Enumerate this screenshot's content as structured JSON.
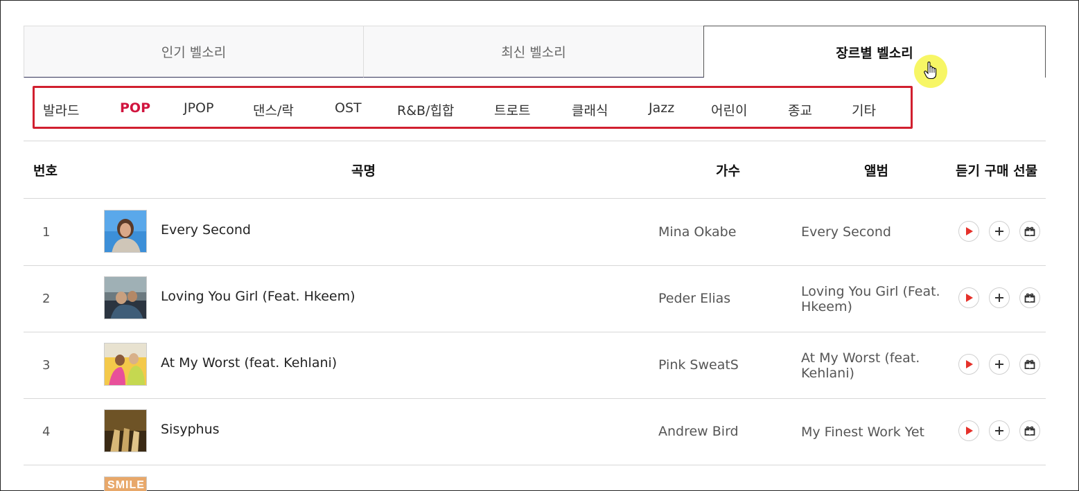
{
  "tabs": [
    "인기 벨소리",
    "최신 벨소리",
    "장르별 벨소리"
  ],
  "active_tab": 2,
  "genres": [
    "발라드",
    "POP",
    "JPOP",
    "댄스/락",
    "OST",
    "R&B/힙합",
    "트로트",
    "클래식",
    "Jazz",
    "어린이",
    "종교",
    "기타"
  ],
  "active_genre": 1,
  "table": {
    "headers": {
      "number": "번호",
      "title": "곡명",
      "artist": "가수",
      "album": "앨범",
      "actions": "듣기 구매 선물"
    },
    "rows": [
      {
        "num": "1",
        "title": "Every Second",
        "artist": "Mina Okabe",
        "album": "Every Second"
      },
      {
        "num": "2",
        "title": "Loving You Girl (Feat. Hkeem)",
        "artist": "Peder Elias",
        "album": "Loving You Girl (Feat. Hkeem)"
      },
      {
        "num": "3",
        "title": "At My Worst (feat. Kehlani)",
        "artist": "Pink SweatS",
        "album": "At My Worst (feat. Kehlani)"
      },
      {
        "num": "4",
        "title": "Sisyphus",
        "artist": "Andrew Bird",
        "album": "My Finest Work Yet"
      }
    ],
    "partial_thumb_text": "SMILE"
  },
  "colors": {
    "accent": "#d1143e",
    "highlight_box": "#d11f2f",
    "cursor_highlight": "#f6f44a"
  },
  "icons": {
    "play": "play-icon",
    "add": "plus-icon",
    "gift": "gift-icon"
  }
}
